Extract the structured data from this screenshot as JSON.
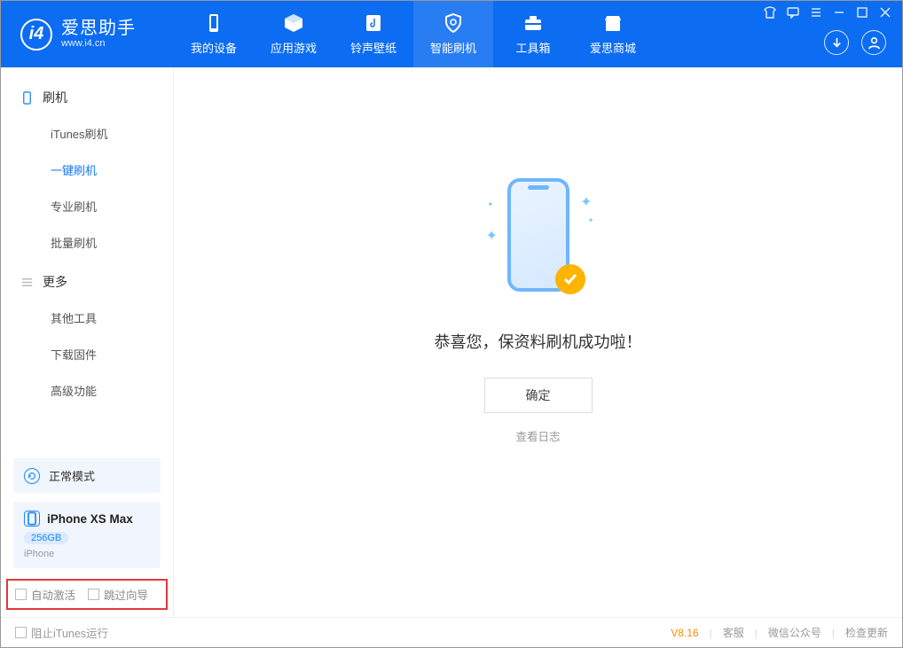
{
  "app": {
    "name": "爱思助手",
    "url": "www.i4.cn"
  },
  "nav": [
    {
      "label": "我的设备",
      "icon": "device"
    },
    {
      "label": "应用游戏",
      "icon": "cube"
    },
    {
      "label": "铃声壁纸",
      "icon": "music"
    },
    {
      "label": "智能刷机",
      "icon": "shield",
      "active": true
    },
    {
      "label": "工具箱",
      "icon": "toolbox"
    },
    {
      "label": "爱思商城",
      "icon": "store"
    }
  ],
  "sidebar": {
    "flash": {
      "title": "刷机",
      "items": [
        {
          "label": "iTunes刷机"
        },
        {
          "label": "一键刷机",
          "active": true
        },
        {
          "label": "专业刷机"
        },
        {
          "label": "批量刷机"
        }
      ]
    },
    "more": {
      "title": "更多",
      "items": [
        {
          "label": "其他工具"
        },
        {
          "label": "下载固件"
        },
        {
          "label": "高级功能"
        }
      ]
    },
    "mode_label": "正常模式",
    "device": {
      "name": "iPhone XS Max",
      "storage": "256GB",
      "type": "iPhone"
    },
    "options": {
      "auto_activate": "自动激活",
      "skip_guide": "跳过向导"
    }
  },
  "main": {
    "success_msg": "恭喜您，保资料刷机成功啦！",
    "ok_btn": "确定",
    "view_log": "查看日志"
  },
  "footer": {
    "block_itunes": "阻止iTunes运行",
    "version": "V8.16",
    "links": [
      "客服",
      "微信公众号",
      "检查更新"
    ]
  }
}
